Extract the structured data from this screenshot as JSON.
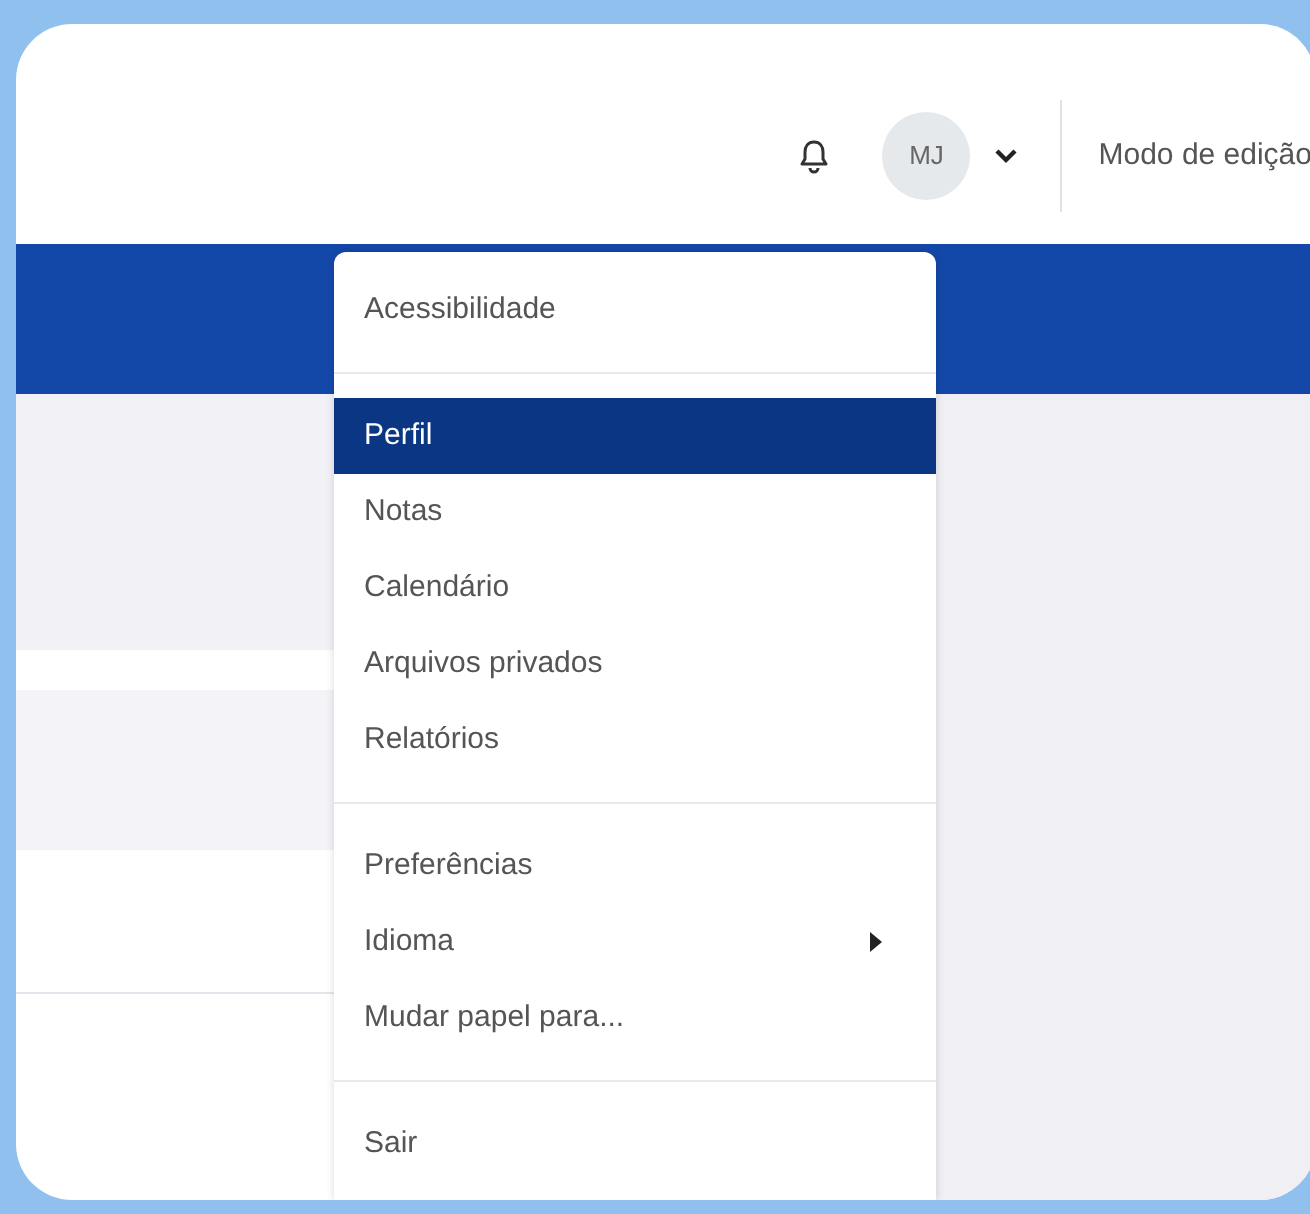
{
  "header": {
    "avatar_initials": "MJ",
    "edit_mode_label": "Modo de edição"
  },
  "user_menu": {
    "items": [
      {
        "kind": "item",
        "label": "Acessibilidade",
        "selected": false,
        "submenu": false
      },
      {
        "kind": "divider"
      },
      {
        "kind": "item",
        "label": "Perfil",
        "selected": true,
        "submenu": false
      },
      {
        "kind": "item",
        "label": "Notas",
        "selected": false,
        "submenu": false
      },
      {
        "kind": "item",
        "label": "Calendário",
        "selected": false,
        "submenu": false
      },
      {
        "kind": "item",
        "label": "Arquivos privados",
        "selected": false,
        "submenu": false
      },
      {
        "kind": "item",
        "label": "Relatórios",
        "selected": false,
        "submenu": false
      },
      {
        "kind": "divider"
      },
      {
        "kind": "item",
        "label": "Preferências",
        "selected": false,
        "submenu": false
      },
      {
        "kind": "item",
        "label": "Idioma",
        "selected": false,
        "submenu": true
      },
      {
        "kind": "item",
        "label": "Mudar papel para...",
        "selected": false,
        "submenu": false
      },
      {
        "kind": "divider"
      },
      {
        "kind": "item",
        "label": "Sair",
        "selected": false,
        "submenu": false
      }
    ]
  }
}
